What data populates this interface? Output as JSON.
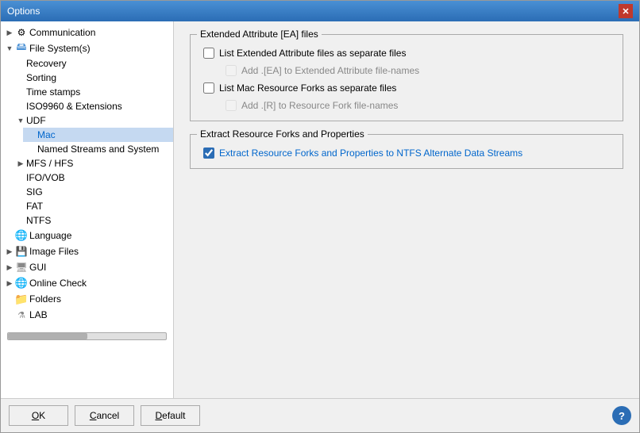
{
  "window": {
    "title": "Options",
    "close_label": "✕"
  },
  "sidebar": {
    "items": [
      {
        "id": "communication",
        "label": "Communication",
        "level": 0,
        "expanded": false,
        "icon": "gear",
        "has_expander": true
      },
      {
        "id": "filesystem",
        "label": "File System(s)",
        "level": 0,
        "expanded": true,
        "icon": "fs",
        "has_expander": true
      },
      {
        "id": "recovery",
        "label": "Recovery",
        "level": 1,
        "expanded": false,
        "icon": "none",
        "has_expander": false
      },
      {
        "id": "sorting",
        "label": "Sorting",
        "level": 1,
        "expanded": false,
        "icon": "none",
        "has_expander": false
      },
      {
        "id": "timestamps",
        "label": "Time stamps",
        "level": 1,
        "expanded": false,
        "icon": "none",
        "has_expander": false
      },
      {
        "id": "iso9960",
        "label": "ISO9960 & Extensions",
        "level": 1,
        "expanded": false,
        "icon": "none",
        "has_expander": false
      },
      {
        "id": "udf",
        "label": "UDF",
        "level": 1,
        "expanded": true,
        "icon": "none",
        "has_expander": true
      },
      {
        "id": "mac",
        "label": "Mac",
        "level": 2,
        "expanded": false,
        "icon": "none",
        "has_expander": false,
        "selected": true
      },
      {
        "id": "named-streams",
        "label": "Named Streams and System",
        "level": 2,
        "expanded": false,
        "icon": "none",
        "has_expander": false
      },
      {
        "id": "mfshfs",
        "label": "MFS / HFS",
        "level": 1,
        "expanded": false,
        "icon": "none",
        "has_expander": true
      },
      {
        "id": "ifovob",
        "label": "IFO/VOB",
        "level": 1,
        "expanded": false,
        "icon": "none",
        "has_expander": false
      },
      {
        "id": "sig",
        "label": "SIG",
        "level": 1,
        "expanded": false,
        "icon": "none",
        "has_expander": false
      },
      {
        "id": "fat",
        "label": "FAT",
        "level": 1,
        "expanded": false,
        "icon": "none",
        "has_expander": false
      },
      {
        "id": "ntfs",
        "label": "NTFS",
        "level": 1,
        "expanded": false,
        "icon": "none",
        "has_expander": false
      },
      {
        "id": "language",
        "label": "Language",
        "level": 0,
        "expanded": false,
        "icon": "lang",
        "has_expander": false
      },
      {
        "id": "image-files",
        "label": "Image Files",
        "level": 0,
        "expanded": false,
        "icon": "image",
        "has_expander": true
      },
      {
        "id": "gui",
        "label": "GUI",
        "level": 0,
        "expanded": false,
        "icon": "gui",
        "has_expander": true
      },
      {
        "id": "online-check",
        "label": "Online Check",
        "level": 0,
        "expanded": false,
        "icon": "online",
        "has_expander": true
      },
      {
        "id": "folders",
        "label": "Folders",
        "level": 0,
        "expanded": false,
        "icon": "folder",
        "has_expander": false
      },
      {
        "id": "lab",
        "label": "LAB",
        "level": 0,
        "expanded": false,
        "icon": "lab",
        "has_expander": false
      }
    ]
  },
  "main": {
    "ea_section_title": "Extended Attribute [EA] files",
    "ea_options": [
      {
        "id": "list-ea",
        "label": "List Extended Attribute files as separate files",
        "checked": false,
        "disabled": false
      },
      {
        "id": "add-ea",
        "label": "Add .[EA] to Extended Attribute file-names",
        "checked": false,
        "disabled": true,
        "sub": true
      },
      {
        "id": "list-mac",
        "label": "List Mac Resource Forks as separate files",
        "checked": false,
        "disabled": false
      },
      {
        "id": "add-r",
        "label": "Add .[R] to Resource Fork file-names",
        "checked": false,
        "disabled": true,
        "sub": true
      }
    ],
    "extract_section_title": "Extract Resource Forks and Properties",
    "extract_options": [
      {
        "id": "extract-ntfs",
        "label": "Extract Resource Forks and Properties to NTFS Alternate Data Streams",
        "checked": true,
        "disabled": false
      }
    ]
  },
  "footer": {
    "ok_label": "OK",
    "cancel_label": "Cancel",
    "default_label": "Default",
    "help_label": "?"
  }
}
